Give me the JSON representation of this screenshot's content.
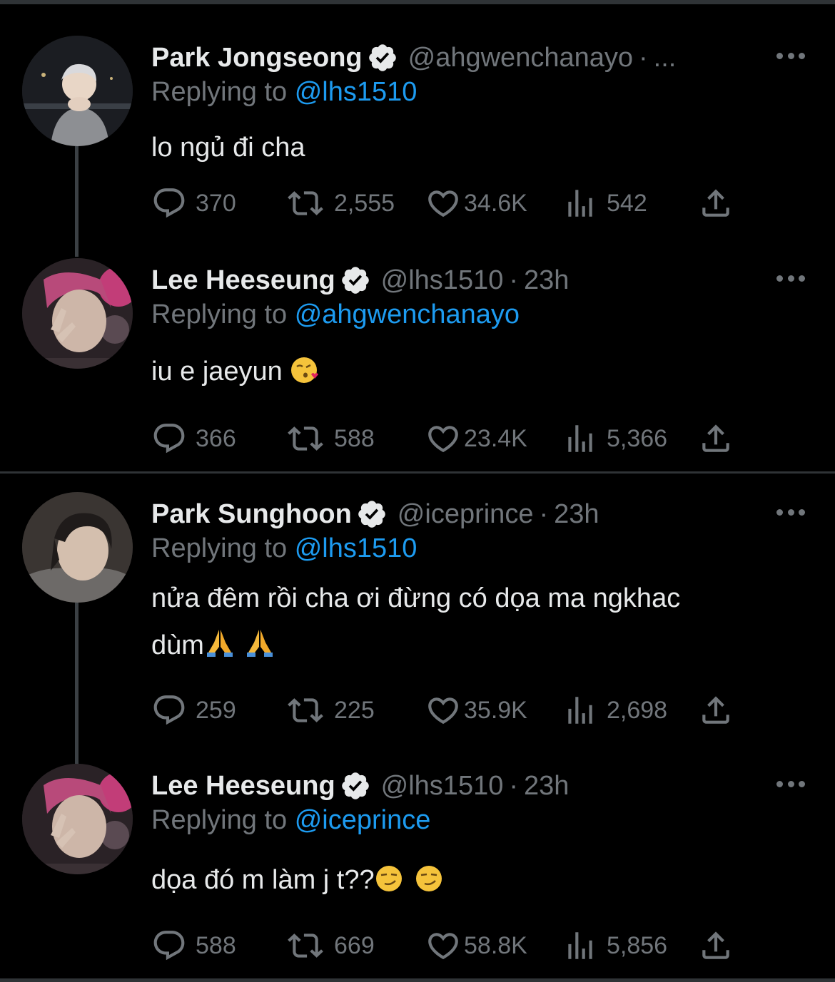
{
  "colors": {
    "background": "#000000",
    "text": "#e7e9ea",
    "muted": "#71767b",
    "link": "#1d9bf0",
    "border": "#2f3336"
  },
  "reply_prefix": "Replying to",
  "icons": {
    "reply": "reply-icon",
    "retweet": "retweet-icon",
    "like": "like-icon",
    "views": "views-icon",
    "share": "share-icon",
    "verified": "verified-badge-icon",
    "more": "more-icon"
  },
  "tweets": [
    {
      "display_name": "Park Jongseong",
      "handle": "@ahgwenchanayo",
      "separator": "·",
      "time": "...",
      "replying_to": "@lhs1510",
      "text": "lo ngủ đi cha",
      "emoji": "",
      "replies": "370",
      "retweets": "2,555",
      "likes": "34.6K",
      "views": "542"
    },
    {
      "display_name": "Lee Heeseung",
      "handle": "@lhs1510",
      "separator": "·",
      "time": "23h",
      "replying_to": "@ahgwenchanayo",
      "text": "iu e jaeyun ",
      "emoji": "kiss",
      "replies": "366",
      "retweets": "588",
      "likes": "23.4K",
      "views": "5,366"
    },
    {
      "display_name": "Park Sunghoon",
      "handle": "@iceprince",
      "separator": "·",
      "time": "23h",
      "replying_to": "@lhs1510",
      "text_line1": "nửa đêm rồi cha ơi đừng có dọa ma ngkhac",
      "text_line2": "dùm",
      "emoji": "pray",
      "replies": "259",
      "retweets": "225",
      "likes": "35.9K",
      "views": "2,698"
    },
    {
      "display_name": "Lee Heeseung",
      "handle": "@lhs1510",
      "separator": "·",
      "time": "23h",
      "replying_to": "@iceprince",
      "text": "dọa đó m làm j t??",
      "emoji": "smirk",
      "replies": "588",
      "retweets": "669",
      "likes": "58.8K",
      "views": "5,856"
    }
  ]
}
